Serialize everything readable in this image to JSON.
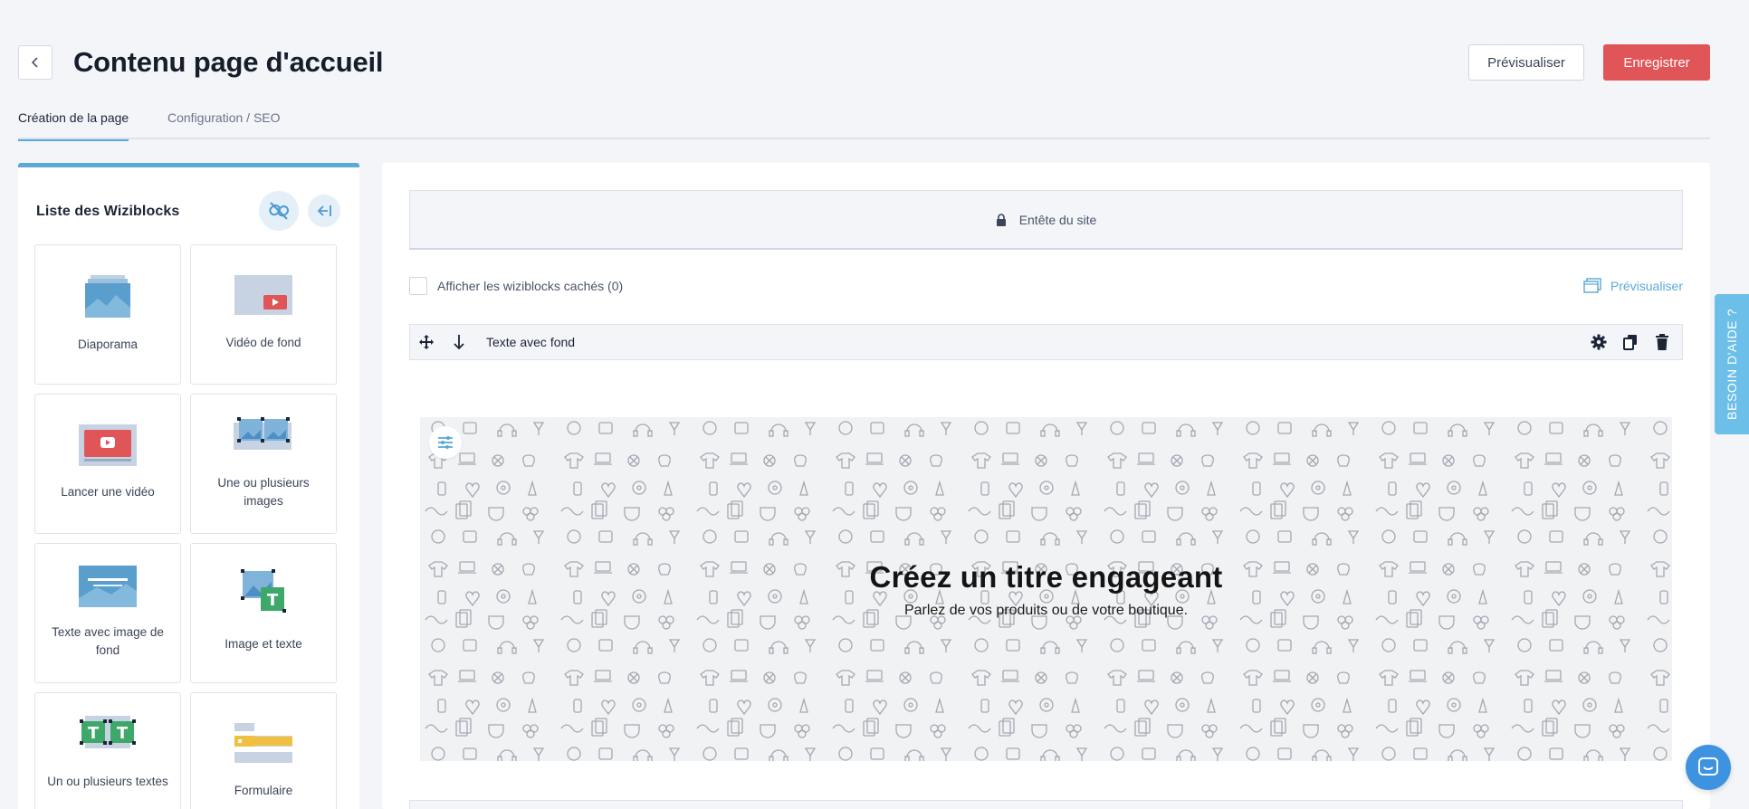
{
  "header": {
    "back_icon": "chevron-left-icon",
    "title": "Contenu page d'accueil",
    "preview_label": "Prévisualiser",
    "save_label": "Enregistrer",
    "accent_color": "#e05558"
  },
  "tabs": [
    {
      "label": "Création de la page",
      "active": true
    },
    {
      "label": "Configuration / SEO",
      "active": false
    }
  ],
  "sidebar": {
    "title": "Liste des Wiziblocks",
    "unlink_icon": "unlink-icon",
    "collapse_icon": "collapse-left-icon",
    "blocks": [
      {
        "label": "Diaporama",
        "icon": "slideshow-icon"
      },
      {
        "label": "Vidéo de fond",
        "icon": "background-video-icon"
      },
      {
        "label": "Lancer une vidéo",
        "icon": "play-video-icon"
      },
      {
        "label": "Une ou plusieurs images",
        "icon": "images-icon"
      },
      {
        "label": "Texte avec image de fond",
        "icon": "text-background-image-icon"
      },
      {
        "label": "Image et texte",
        "icon": "image-text-icon"
      },
      {
        "label": "Un ou plusieurs textes",
        "icon": "texts-icon"
      },
      {
        "label": "Formulaire",
        "icon": "form-icon"
      }
    ]
  },
  "editor": {
    "site_header_label": "Entête du site",
    "show_hidden_label": "Afficher les wiziblocks cachés (0)",
    "preview_link_label": "Prévisualiser",
    "block_bar": {
      "label": "Texte avec fond",
      "move_icon": "move-icon",
      "down_icon": "arrow-down-icon",
      "settings_icon": "gear-icon",
      "duplicate_icon": "duplicate-icon",
      "delete_icon": "trash-icon"
    },
    "hero": {
      "title": "Créez un titre engageant",
      "subtitle": "Parlez de vos produits ou de votre boutique.",
      "settings_icon": "sliders-icon"
    }
  },
  "help_tab_label": "BESOIN D'AIDE ?",
  "chat_icon": "chat-icon",
  "colors": {
    "primary": "#5aa9d6",
    "danger": "#e05558",
    "help": "#6cbfe8",
    "chat": "#3d93e0"
  }
}
